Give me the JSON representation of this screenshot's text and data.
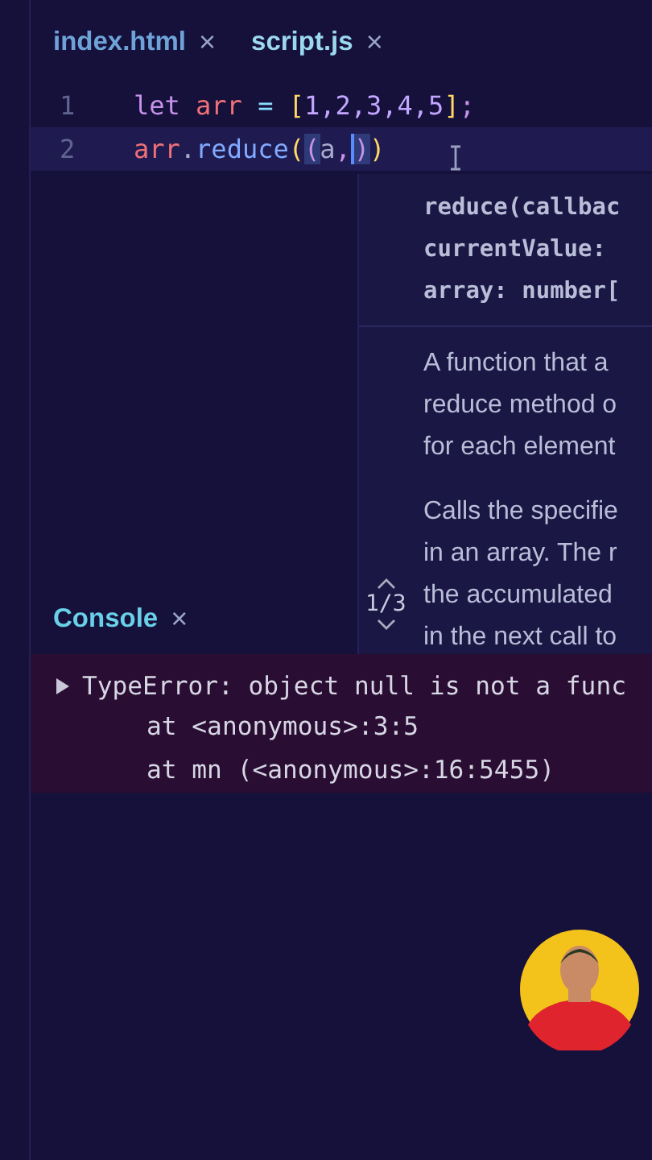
{
  "tabs": [
    {
      "label": "index.html",
      "close": "×",
      "selected": false
    },
    {
      "label": "script.js",
      "close": "×",
      "selected": true
    }
  ],
  "editor": {
    "lines": [
      {
        "number": "1",
        "current": false,
        "tokens": [
          {
            "text": "let ",
            "kind": "keyword",
            "selected": false
          },
          {
            "text": "arr",
            "kind": "variable",
            "selected": false
          },
          {
            "text": " = ",
            "kind": "operator",
            "selected": false
          },
          {
            "text": "[",
            "kind": "bracket",
            "selected": false
          },
          {
            "text": "1,2,3,4,5",
            "kind": "number",
            "selected": false
          },
          {
            "text": "]",
            "kind": "bracket",
            "selected": false
          },
          {
            "text": ";",
            "kind": "punct",
            "selected": false
          }
        ]
      },
      {
        "number": "2",
        "current": true,
        "tokens": [
          {
            "text": "arr",
            "kind": "variable",
            "selected": false
          },
          {
            "text": ".",
            "kind": "plain",
            "selected": false
          },
          {
            "text": "reduce",
            "kind": "function",
            "selected": false
          },
          {
            "text": "(",
            "kind": "bracket",
            "selected": false
          },
          {
            "text": "(",
            "kind": "bracket2",
            "selected": true
          },
          {
            "text": "a",
            "kind": "plain",
            "selected": false
          },
          {
            "text": ",",
            "kind": "punct",
            "selected": false
          },
          {
            "text": ")",
            "kind": "bracket2",
            "selected": true,
            "caret": true
          },
          {
            "text": ")",
            "kind": "bracket",
            "selected": false
          }
        ]
      }
    ]
  },
  "tooltip": {
    "signature": [
      "reduce(callbac",
      "currentValue:",
      "array: number["
    ],
    "paragraphs": [
      [
        "A function that a",
        "reduce method o",
        "for each element"
      ],
      [
        "Calls the specifie",
        "in an array. The r",
        "the accumulated",
        "in the next call to"
      ]
    ],
    "overload": "1/3"
  },
  "console": {
    "title": "Console",
    "close": "×",
    "error": {
      "expanded": false,
      "message": "TypeError: object null is not a func",
      "stack": [
        "at <anonymous>:3:5",
        "at mn (<anonymous>:16:5455)"
      ]
    }
  }
}
